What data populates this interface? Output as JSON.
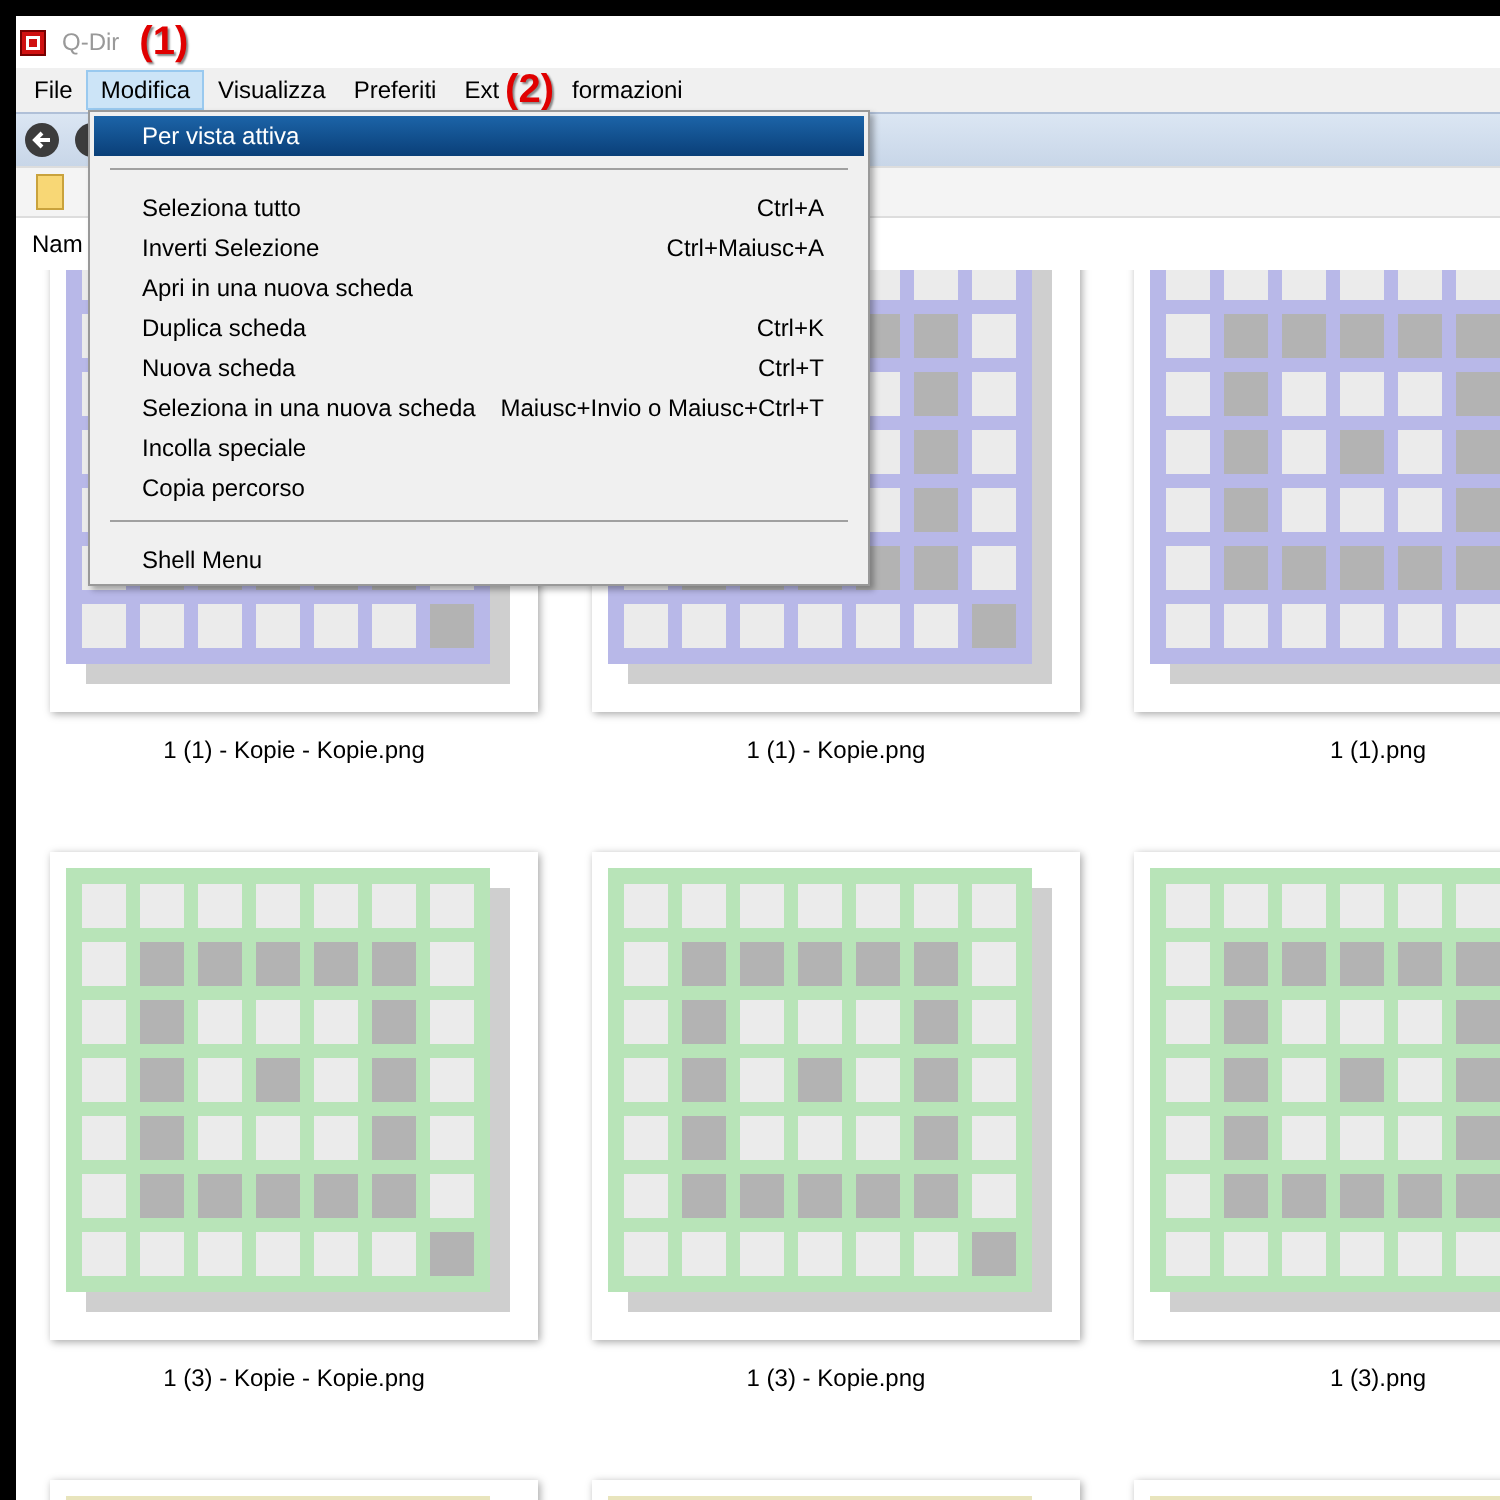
{
  "window": {
    "title": "Q-Dir"
  },
  "annotations": [
    {
      "label": "(1)"
    },
    {
      "label": "(2)"
    }
  ],
  "menu_bar": [
    {
      "label": "File",
      "selected": false
    },
    {
      "label": "Modifica",
      "selected": true
    },
    {
      "label": "Visualizza",
      "selected": false
    },
    {
      "label": "Preferiti",
      "selected": false
    },
    {
      "label": "Ext",
      "selected": false
    },
    {
      "label": "formazioni",
      "selected": false
    }
  ],
  "column_header": "Nam",
  "dropdown_menu": [
    {
      "kind": "item",
      "label": "Per vista attiva",
      "selected": true
    },
    {
      "kind": "separator"
    },
    {
      "kind": "item",
      "label": "Seleziona tutto",
      "shortcut": "Ctrl+A",
      "selected": false
    },
    {
      "kind": "item",
      "label": "Inverti Selezione",
      "shortcut": "Ctrl+Maiusc+A",
      "selected": false
    },
    {
      "kind": "item",
      "label": "Apri in una nuova scheda",
      "selected": false
    },
    {
      "kind": "item",
      "label": "Duplica scheda",
      "shortcut": "Ctrl+K",
      "selected": false
    },
    {
      "kind": "item",
      "label": "Nuova scheda",
      "shortcut": "Ctrl+T",
      "selected": false
    },
    {
      "kind": "item",
      "label": "Seleziona in una nuova scheda",
      "shortcut": "Maiusc+Invio o Maiusc+Ctrl+T",
      "selected": false
    },
    {
      "kind": "item",
      "label": "Incolla speciale",
      "selected": false
    },
    {
      "kind": "item",
      "label": "Copia percorso",
      "selected": false
    },
    {
      "kind": "separator"
    },
    {
      "kind": "item",
      "label": "Shell Menu",
      "selected": false
    }
  ],
  "files": [
    {
      "name": "1 (1) - Kopie - Kopie.png",
      "color": "#b8b8e8"
    },
    {
      "name": "1 (1) - Kopie.png",
      "color": "#b8b8e8"
    },
    {
      "name": "1 (1).png",
      "color": "#b8b8e8"
    },
    {
      "name": "1 (3) - Kopie - Kopie.png",
      "color": "#b8e4b8"
    },
    {
      "name": "1 (3) - Kopie.png",
      "color": "#b8e4b8"
    },
    {
      "name": "1 (3).png",
      "color": "#b8e4b8"
    },
    {
      "color": "#e8e4bc"
    },
    {
      "color": "#e8e4bc"
    },
    {
      "color": "#e8e4bc"
    }
  ]
}
